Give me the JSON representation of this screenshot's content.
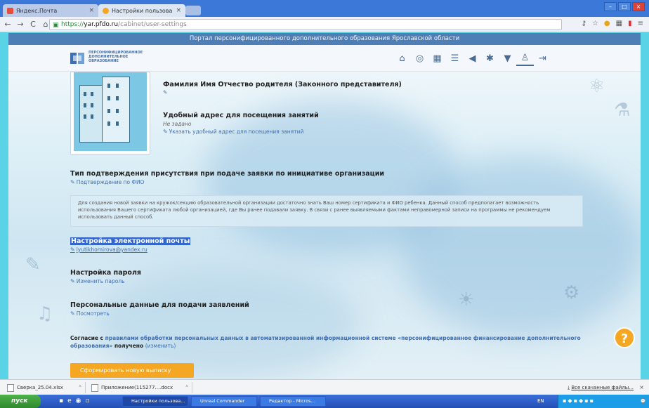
{
  "browser": {
    "tabs": [
      {
        "label": "Яндекс.Почта",
        "active": false
      },
      {
        "label": "Настройки пользователя",
        "active": true
      }
    ],
    "url_prefix": "https://",
    "url_host": "yar.pfdo.ru",
    "url_path": "/cabinet/user-settings"
  },
  "site": {
    "portal_title": "Портал персонифицированного дополнительного образования Ярославской области",
    "logo_text": "ПЕРСОНИФИЦИРОВАННОЕ ДОПОЛНИТЕЛЬНОЕ ОБРАЗОВАНИЕ",
    "nav_icons": [
      "home-icon",
      "coin-icon",
      "calendar-icon",
      "list-icon",
      "megaphone-icon",
      "star-icon",
      "trophy-icon",
      "user-icon",
      "logout-icon"
    ]
  },
  "profile": {
    "parent_name": "Фамилия Имя Отчество родителя (Законного представителя)",
    "address_title": "Удобный адрес для посещения занятий",
    "address_value": "Не задано",
    "address_link": "Указать удобный адрес для посещения занятий",
    "confirm_title": "Тип подтверждения присутствия при подаче заявки по инициативе организации",
    "confirm_link": "Подтверждение по ФИО",
    "info_text": "Для создания новой заявки на кружок/секцию образовательной организации достаточно знать Ваш номер сертификата и ФИО ребенка. Данный способ предполагает возможность использования Вашего сертификата любой организацией, где Вы ранее подавали заявку. В связи с ранее выявляемыми фактами неправомерной записи на программы не рекомендуем использовать данный способ.",
    "email_title": "Настройка электронной почты",
    "email_value": "lyutikhomirova@yandex.ru",
    "password_title": "Настройка пароля",
    "password_link": "Изменить пароль",
    "personal_title": "Персональные данные для подачи заявлений",
    "personal_link": "Посмотреть",
    "consent_pre": "Согласие с ",
    "consent_link": "правилами обработки персональных данных в автоматизированной информационной системе «персонифицированное финансирование дополнительного образования»",
    "consent_status": " получено ",
    "consent_change": "(изменить)",
    "extract_button": "Сформировать новую выписку"
  },
  "downloads": {
    "items": [
      "Сверка_25.04.xlsx",
      "Приложение(115277....docx"
    ],
    "show_all": "Все скачанные файлы..."
  },
  "taskbar": {
    "start": "пуск",
    "tasks": [
      "Настройки пользова...",
      "Unreal Commander",
      "Редактор - Micros..."
    ],
    "lang": "EN"
  }
}
